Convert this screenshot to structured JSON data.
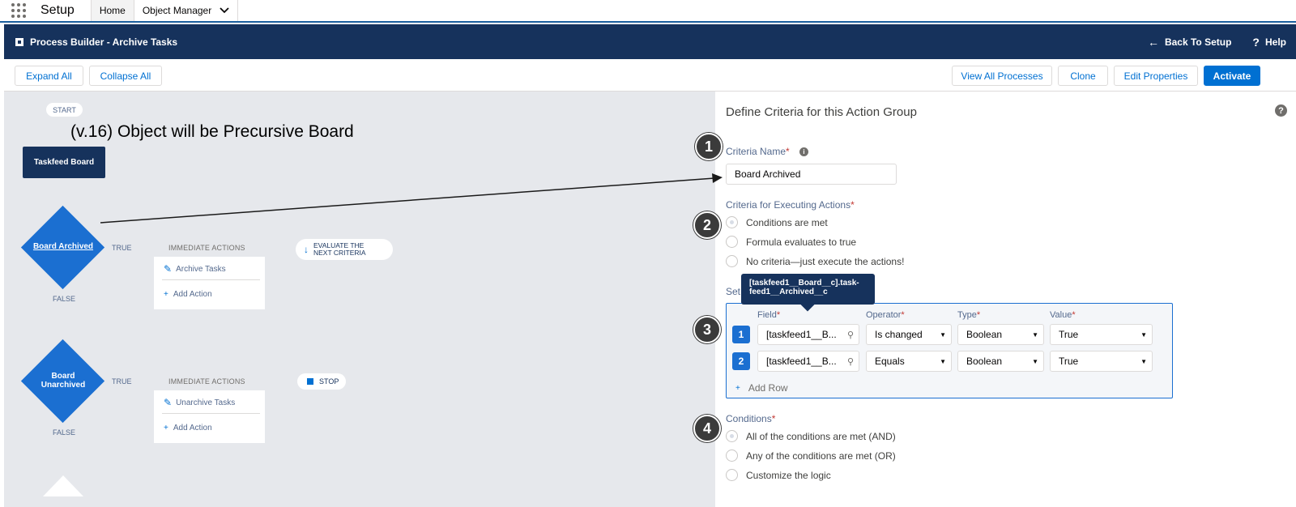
{
  "setup_bar": {
    "title": "Setup",
    "tabs": [
      "Home",
      "Object Manager"
    ]
  },
  "header": {
    "title": "Process Builder - Archive Tasks",
    "back_label": "Back To Setup",
    "help_label": "Help"
  },
  "toolbar": {
    "expand_all": "Expand All",
    "collapse_all": "Collapse All",
    "view_all": "View All Processes",
    "clone": "Clone",
    "edit_properties": "Edit Properties",
    "activate": "Activate"
  },
  "canvas": {
    "start": "START",
    "annotation": "(v.16) Object will be Precursive Board",
    "object_node": "Taskfeed Board",
    "criteria": [
      {
        "name": "Board Archived",
        "true_label": "TRUE",
        "false_label": "FALSE",
        "actions_header": "IMMEDIATE ACTIONS",
        "action": "Archive Tasks",
        "add_action": "Add Action",
        "next": "EVALUATE THE NEXT CRITERIA"
      },
      {
        "name": "Board Unarchived",
        "true_label": "TRUE",
        "false_label": "FALSE",
        "actions_header": "IMMEDIATE ACTIONS",
        "action": "Unarchive Tasks",
        "add_action": "Add Action",
        "next": "STOP"
      }
    ]
  },
  "panel": {
    "title": "Define Criteria for this Action Group",
    "criteria_name_label": "Criteria Name",
    "criteria_name_value": "Board Archived",
    "exec_label": "Criteria for Executing Actions",
    "exec_options": [
      "Conditions are met",
      "Formula evaluates to true",
      "No criteria—just execute the actions!"
    ],
    "set_label": "Set",
    "tooltip": "[taskfeed1__Board__c].task-feed1__Archived__c",
    "columns": [
      "Field",
      "Operator",
      "Type",
      "Value"
    ],
    "rows": [
      {
        "num": "1",
        "field": "[taskfeed1__B...",
        "operator": "Is changed",
        "type": "Boolean",
        "value": "True"
      },
      {
        "num": "2",
        "field": "[taskfeed1__B...",
        "operator": "Equals",
        "type": "Boolean",
        "value": "True"
      }
    ],
    "add_row": "Add Row",
    "conditions_label": "Conditions",
    "conditions_options": [
      "All of the conditions are met (AND)",
      "Any of the conditions are met (OR)",
      "Customize the logic"
    ]
  },
  "steps": [
    "1",
    "2",
    "3",
    "4"
  ],
  "colors": {
    "navy": "#16325c",
    "blue": "#0070d2",
    "diamond": "#1b6fd1",
    "canvas": "#e6e8ec"
  }
}
